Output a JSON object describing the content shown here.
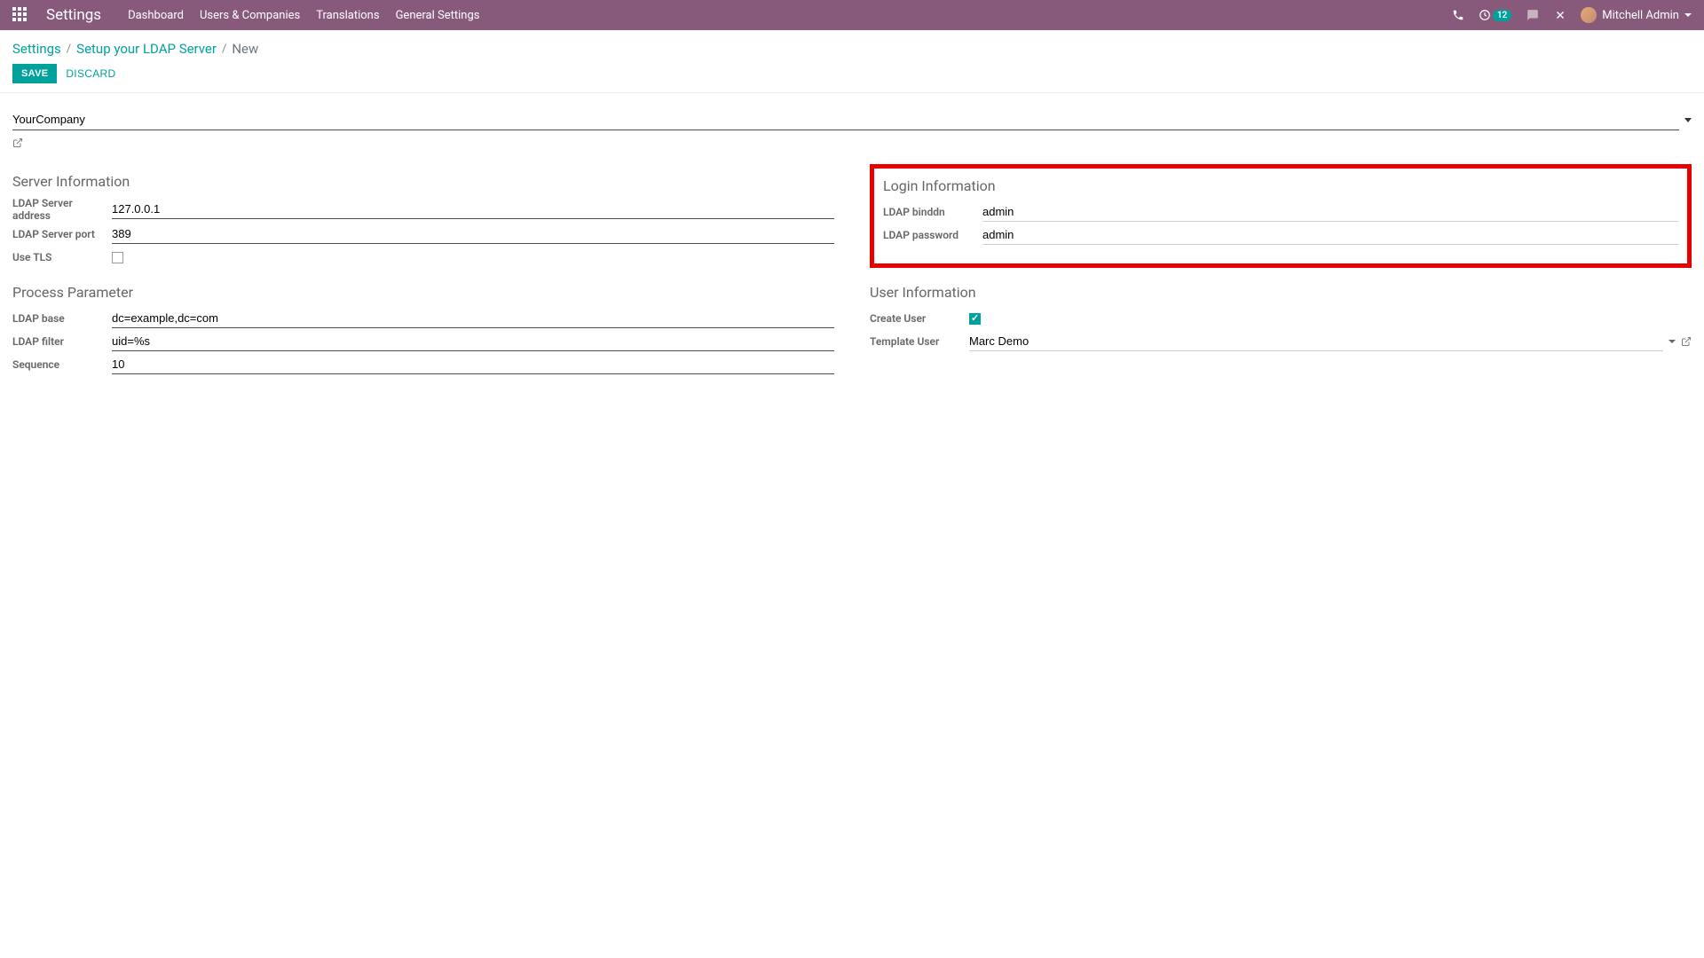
{
  "topbar": {
    "title": "Settings",
    "nav": [
      "Dashboard",
      "Users & Companies",
      "Translations",
      "General Settings"
    ],
    "activities_count": "12",
    "user_name": "Mitchell Admin"
  },
  "breadcrumb": {
    "items": [
      "Settings",
      "Setup your LDAP Server"
    ],
    "current": "New"
  },
  "actions": {
    "save": "SAVE",
    "discard": "DISCARD"
  },
  "form": {
    "company": "YourCompany",
    "sections": {
      "server": {
        "title": "Server Information",
        "address_label": "LDAP Server address",
        "address": "127.0.0.1",
        "port_label": "LDAP Server port",
        "port": "389",
        "tls_label": "Use TLS",
        "tls": false
      },
      "login": {
        "title": "Login Information",
        "binddn_label": "LDAP binddn",
        "binddn": "admin",
        "password_label": "LDAP password",
        "password": "admin"
      },
      "process": {
        "title": "Process Parameter",
        "base_label": "LDAP base",
        "base": "dc=example,dc=com",
        "filter_label": "LDAP filter",
        "filter": "uid=%s",
        "sequence_label": "Sequence",
        "sequence": "10"
      },
      "user": {
        "title": "User Information",
        "create_label": "Create User",
        "create": true,
        "template_label": "Template User",
        "template": "Marc Demo"
      }
    }
  }
}
